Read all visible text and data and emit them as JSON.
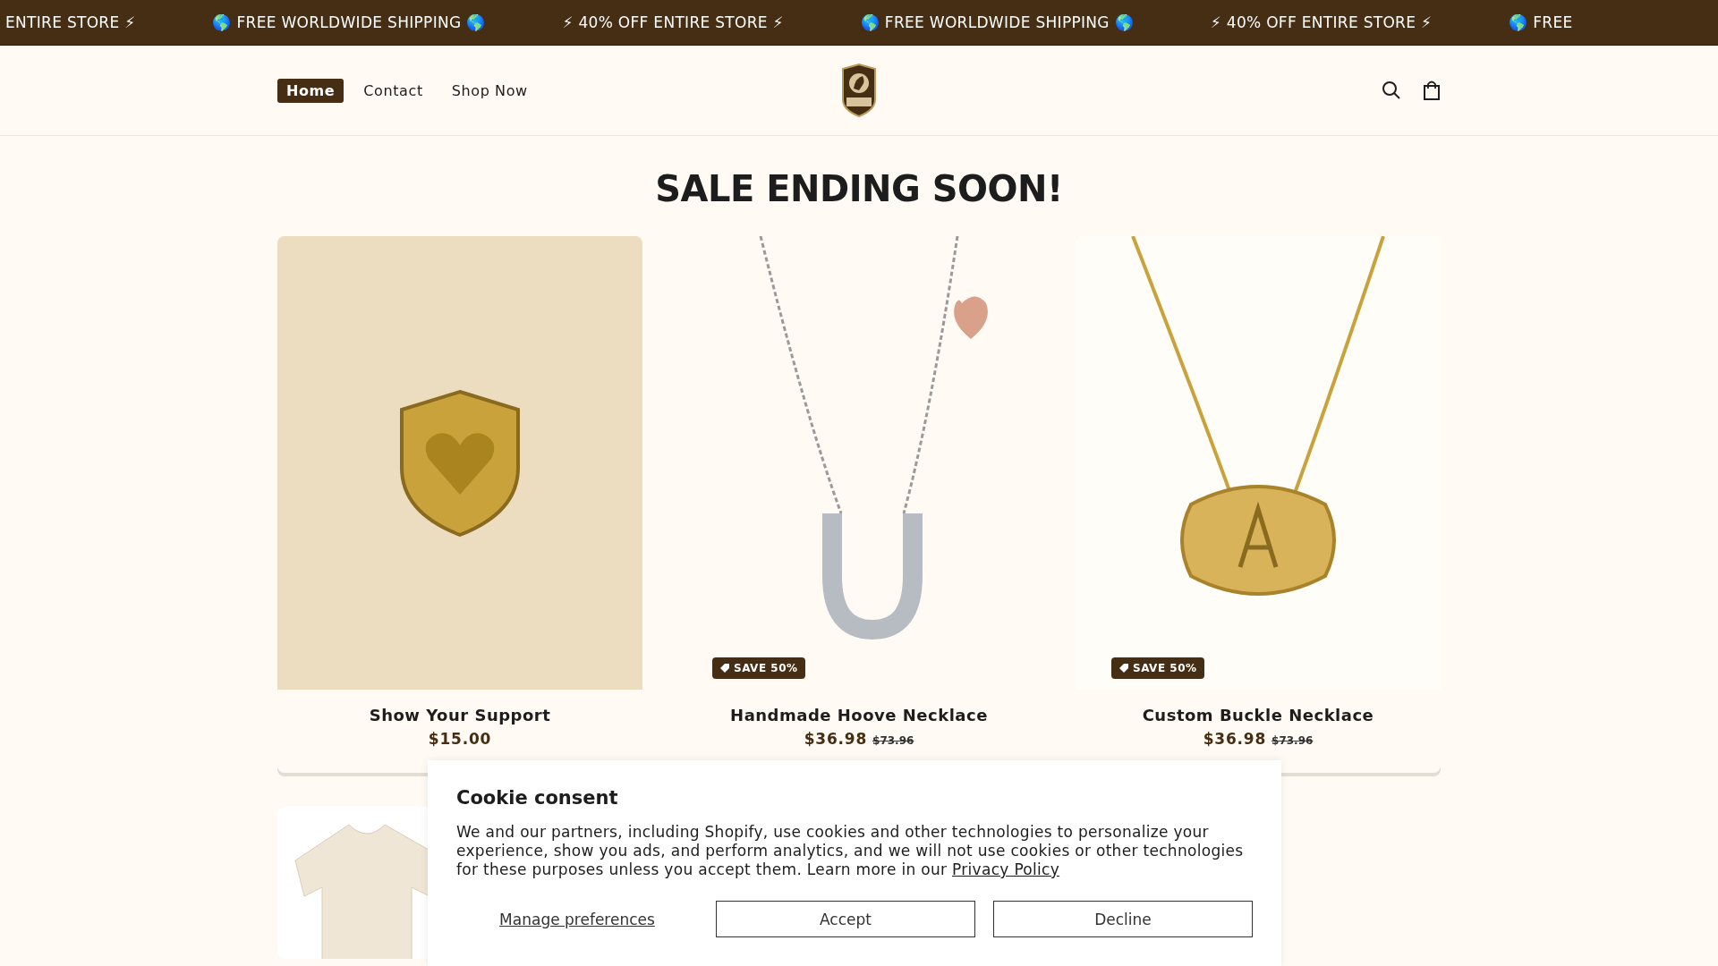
{
  "announcement": {
    "items": [
      "ENTIRE STORE ⚡",
      "🌎 FREE WORLDWIDE SHIPPING 🌎",
      "⚡ 40% OFF ENTIRE STORE ⚡",
      "🌎 FREE WORLDWIDE SHIPPING 🌎",
      "⚡ 40% OFF ENTIRE STORE ⚡",
      "🌎 FREE"
    ]
  },
  "header": {
    "nav": [
      {
        "label": "Home",
        "selected": true
      },
      {
        "label": "Contact",
        "selected": false
      },
      {
        "label": "Shop Now",
        "selected": false
      }
    ]
  },
  "section": {
    "title": "SALE ENDING SOON!"
  },
  "products": [
    {
      "name": "Show Your Support",
      "price": "$15.00",
      "kind": "support"
    },
    {
      "name": "Handmade Hoove Necklace",
      "price": "$36.98",
      "compare_price": "$73.96",
      "badge": "SAVE 50%",
      "kind": "horseshoe"
    },
    {
      "name": "Custom Buckle Necklace",
      "price": "$36.98",
      "compare_price": "$73.96",
      "badge": "SAVE 50%",
      "kind": "buckle"
    },
    {
      "kind": "shirt"
    }
  ],
  "cookie": {
    "title": "Cookie consent",
    "text": "We and our partners, including Shopify, use cookies and other technologies to personalize your experience, show you ads, and perform analytics, and we will not use cookies or other technologies for these purposes unless you accept them. Learn more in our",
    "link": "Privacy Policy",
    "buttons": [
      {
        "label": "Manage preferences",
        "kind": "link"
      },
      {
        "label": "Accept",
        "kind": "outline"
      },
      {
        "label": "Decline",
        "kind": "outline"
      }
    ]
  }
}
